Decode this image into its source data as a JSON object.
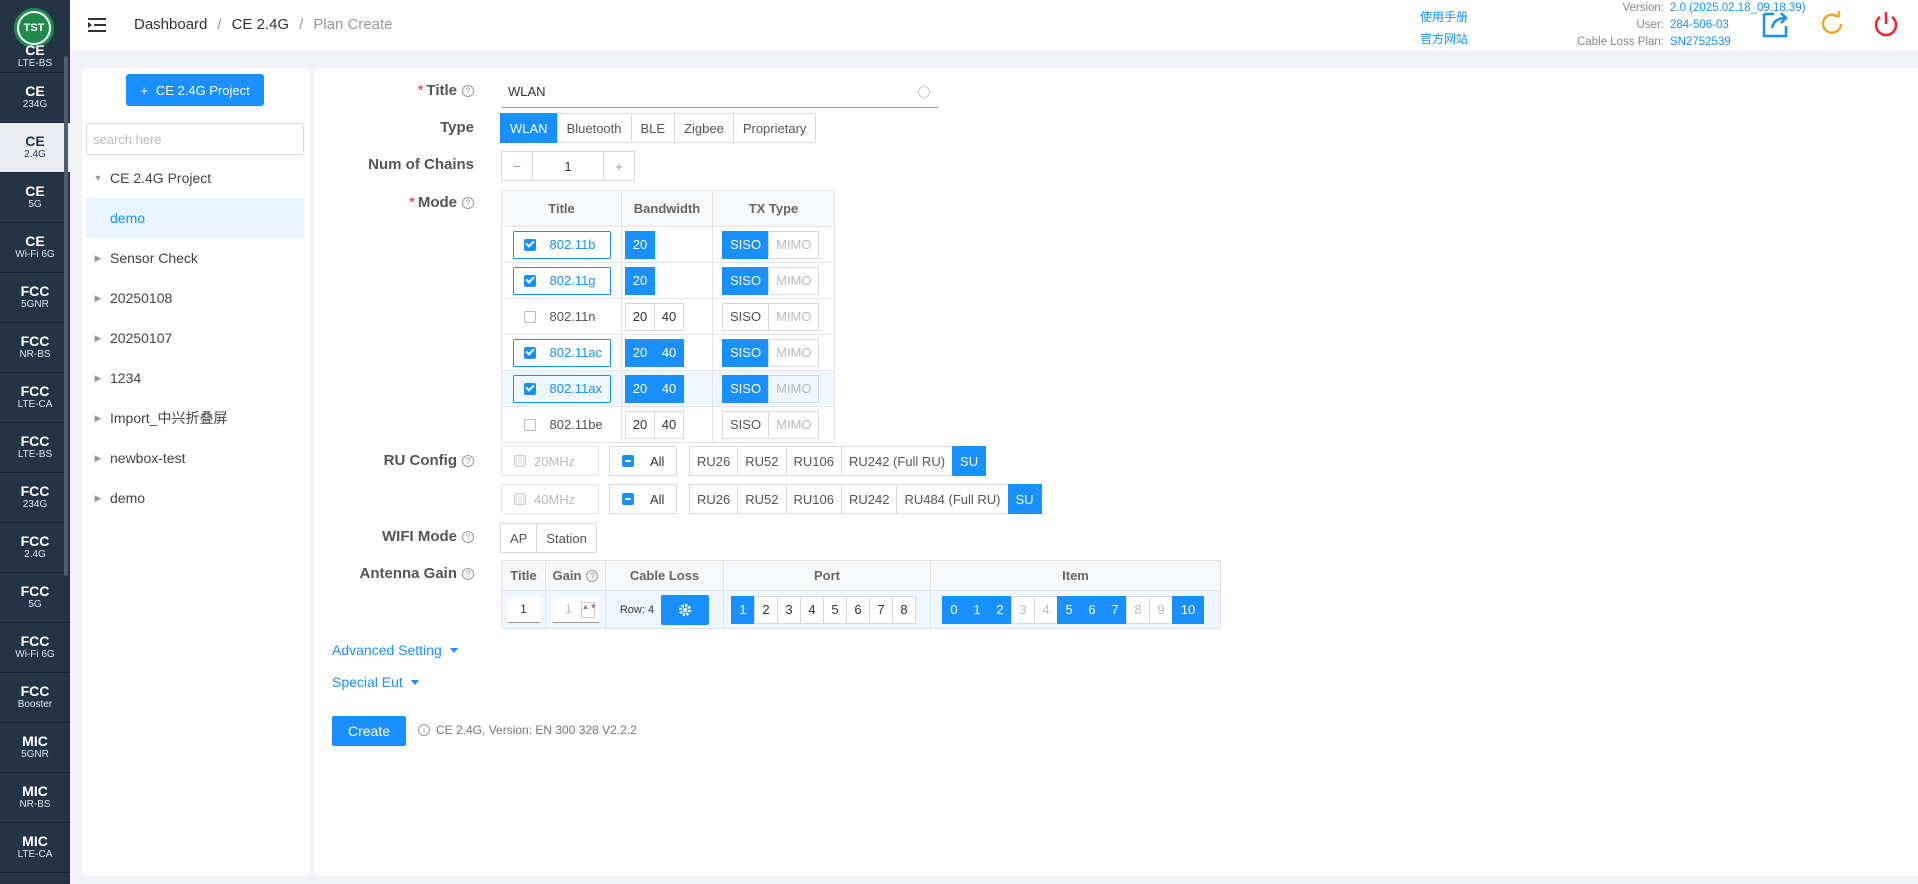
{
  "nav": {
    "logo_text": "TST",
    "items": [
      {
        "t1": "CE",
        "t2": "LTE-BS"
      },
      {
        "t1": "CE",
        "t2": "234G"
      },
      {
        "t1": "CE",
        "t2": "2.4G"
      },
      {
        "t1": "CE",
        "t2": "5G"
      },
      {
        "t1": "CE",
        "t2": "Wi-Fi 6G"
      },
      {
        "t1": "FCC",
        "t2": "5GNR"
      },
      {
        "t1": "FCC",
        "t2": "NR-BS"
      },
      {
        "t1": "FCC",
        "t2": "LTE-CA"
      },
      {
        "t1": "FCC",
        "t2": "LTE-BS"
      },
      {
        "t1": "FCC",
        "t2": "234G"
      },
      {
        "t1": "FCC",
        "t2": "2.4G"
      },
      {
        "t1": "FCC",
        "t2": "5G"
      },
      {
        "t1": "FCC",
        "t2": "Wi-Fi 6G"
      },
      {
        "t1": "FCC",
        "t2": "Booster"
      },
      {
        "t1": "MIC",
        "t2": "5GNR"
      },
      {
        "t1": "MIC",
        "t2": "NR-BS"
      },
      {
        "t1": "MIC",
        "t2": "LTE-CA"
      }
    ]
  },
  "header": {
    "breadcrumb": [
      "Dashboard",
      "CE 2.4G",
      "Plan Create"
    ],
    "links": [
      "使用手册",
      "官方网站"
    ],
    "info": [
      {
        "k": "Version:",
        "v": "2.0 (2025.02.18_09.18.39)"
      },
      {
        "k": "User:",
        "v": "284-506-03"
      },
      {
        "k": "Cable Loss Plan:",
        "v": "SN2752539"
      }
    ]
  },
  "tree": {
    "add_label": "CE 2.4G Project",
    "search_placeholder": "search here",
    "nodes": [
      "CE 2.4G Project",
      "demo",
      "Sensor Check",
      "20250108",
      "20250107",
      "1234",
      "Import_中兴折叠屏",
      "newbox-test",
      "demo"
    ]
  },
  "form": {
    "title_label": "Title",
    "title_value": "WLAN",
    "type_label": "Type",
    "types": [
      "WLAN",
      "Bluetooth",
      "BLE",
      "Zigbee",
      "Proprietary"
    ],
    "chains_label": "Num of Chains",
    "chains_value": "1",
    "minus": "−",
    "plus": "+",
    "mode_label": "Mode",
    "mode_headers": [
      "Title",
      "Bandwidth",
      "TX Type"
    ],
    "modes": [
      {
        "name": "802.11b",
        "checked": true,
        "bw": [
          "20"
        ],
        "bw_on": [
          true
        ]
      },
      {
        "name": "802.11g",
        "checked": true,
        "bw": [
          "20"
        ],
        "bw_on": [
          true
        ]
      },
      {
        "name": "802.11n",
        "checked": false,
        "bw": [
          "20",
          "40"
        ],
        "bw_on": [
          false,
          false
        ]
      },
      {
        "name": "802.11ac",
        "checked": true,
        "bw": [
          "20",
          "40"
        ],
        "bw_on": [
          true,
          true
        ]
      },
      {
        "name": "802.11ax",
        "checked": true,
        "bw": [
          "20",
          "40"
        ],
        "bw_on": [
          true,
          true
        ]
      },
      {
        "name": "802.11be",
        "checked": false,
        "bw": [
          "20",
          "40"
        ],
        "bw_on": [
          false,
          false
        ]
      }
    ],
    "siso": "SISO",
    "mimo": "MIMO",
    "ru_label": "RU Config",
    "ru_rows": [
      {
        "bw": "20MHz",
        "all": "All",
        "items": [
          "RU26",
          "RU52",
          "RU106",
          "RU242 (Full RU)",
          "SU"
        ]
      },
      {
        "bw": "40MHz",
        "all": "All",
        "items": [
          "RU26",
          "RU52",
          "RU106",
          "RU242",
          "RU484 (Full RU)",
          "SU"
        ]
      }
    ],
    "wifi_label": "WIFI Mode",
    "wifi_modes": [
      "AP",
      "Station"
    ],
    "ant_label": "Antenna Gain",
    "ant_headers": [
      "Title",
      "Gain",
      "Cable Loss",
      "Port",
      "Item"
    ],
    "ant_title_value": "1",
    "ant_gain_value": "1",
    "ant_row": "Row: 4",
    "ports": [
      "1",
      "2",
      "3",
      "4",
      "5",
      "6",
      "7",
      "8"
    ],
    "items": [
      "0",
      "1",
      "2",
      "3",
      "4",
      "5",
      "6",
      "7",
      "8",
      "9",
      "10"
    ],
    "advanced": "Advanced Setting",
    "special": "Special Eut",
    "create": "Create",
    "note": "CE 2.4G, Version: EN 300 328 V2.2.2"
  }
}
